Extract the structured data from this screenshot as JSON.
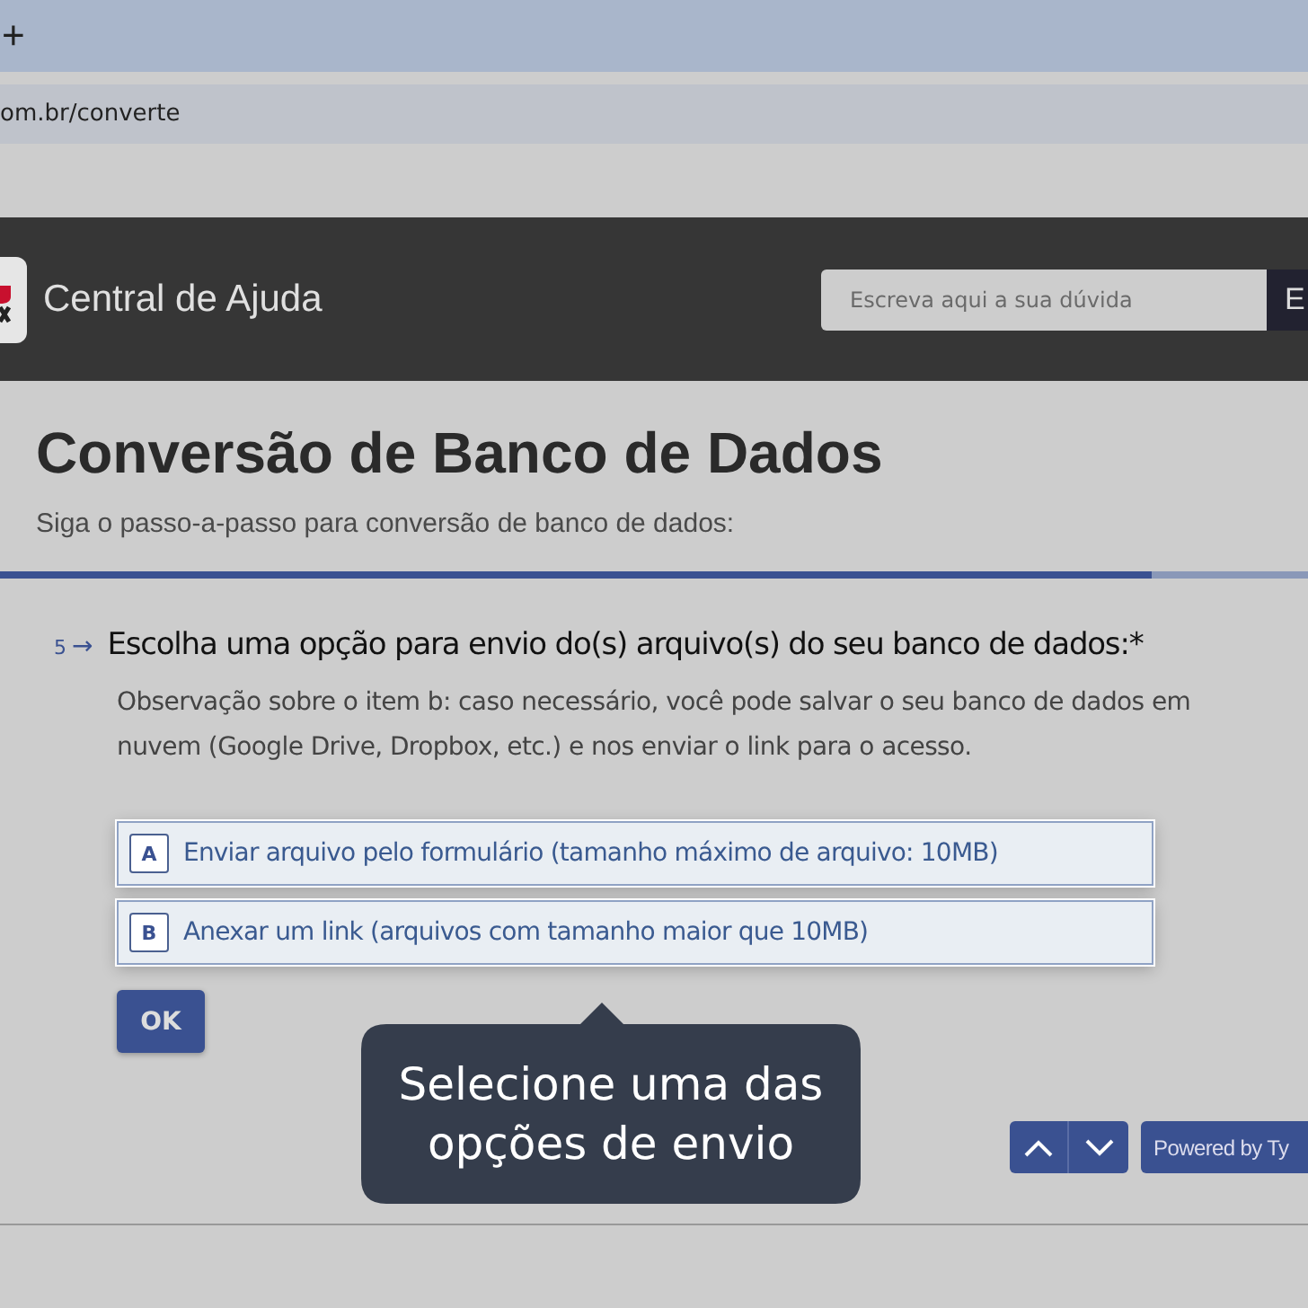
{
  "browser": {
    "new_tab": "+",
    "url": "om.br/converte"
  },
  "header": {
    "title": "Central de Ajuda",
    "search": {
      "placeholder": "Escreva aqui a sua dúvida"
    },
    "search_button": "E"
  },
  "page": {
    "title": "Conversão de Banco de Dados",
    "subtitle": "Siga o passo-a-passo para conversão de banco de dados:"
  },
  "progress": {
    "level": 0.88
  },
  "question": {
    "number": "5",
    "arrow": "→",
    "text": "Escolha uma opção para envio do(s) arquivo(s) do seu banco de dados:*",
    "description": "Observação sobre o item b: caso necessário, você pode salvar o seu banco de dados em nuvem (Google Drive, Dropbox, etc.) e nos enviar o link para o acesso.",
    "options": [
      {
        "key": "A",
        "label": "Enviar arquivo pelo formulário (tamanho máximo de arquivo: 10MB)",
        "selected": false
      },
      {
        "key": "B",
        "label": "Anexar um link (arquivos com tamanho maior que 10MB)",
        "selected": false
      }
    ],
    "ok": "OK"
  },
  "tooltip": "Selecione uma das opções de envio",
  "powered_by": "Powered by Ty"
}
